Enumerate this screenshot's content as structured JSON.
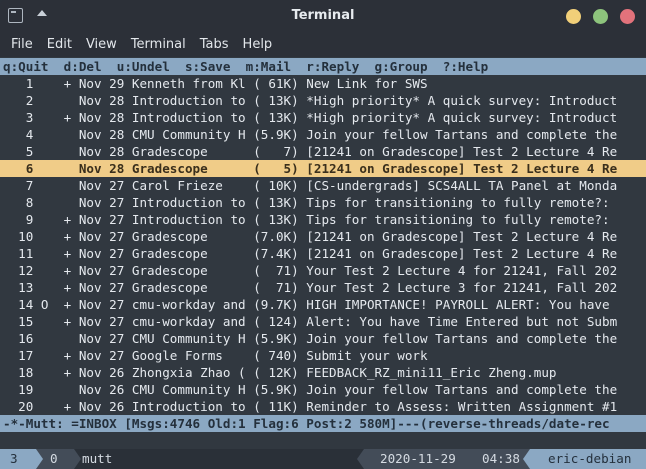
{
  "window": {
    "title": "Terminal"
  },
  "menu": [
    "File",
    "Edit",
    "View",
    "Terminal",
    "Tabs",
    "Help"
  ],
  "mutt": {
    "help": "q:Quit  d:Del  u:Undel  s:Save  m:Mail  r:Reply  g:Group  ?:Help",
    "messages": [
      "   1    + Nov 29 Kenneth from Kl ( 61K) New Link for SWS",
      "   2      Nov 28 Introduction to ( 13K) *High priority* A quick survey: Introduct",
      "   3    + Nov 28 Introduction to ( 13K) *High priority* A quick survey: Introduct",
      "   4      Nov 28 CMU Community H (5.9K) Join your fellow Tartans and complete the",
      "   5      Nov 28 Gradescope      (   7) [21241 on Gradescope] Test 2 Lecture 4 Re",
      "   6      Nov 28 Gradescope      (   5) [21241 on Gradescope] Test 2 Lecture 4 Re",
      "   7      Nov 27 Carol Frieze    ( 10K) [CS-undergrads] SCS4ALL TA Panel at Monda",
      "   8      Nov 27 Introduction to ( 13K) Tips for transitioning to fully remote?: ",
      "   9    + Nov 27 Introduction to ( 13K) Tips for transitioning to fully remote?: ",
      "  10    + Nov 27 Gradescope      (7.0K) [21241 on Gradescope] Test 2 Lecture 4 Re",
      "  11    + Nov 27 Gradescope      (7.4K) [21241 on Gradescope] Test 2 Lecture 4 Re",
      "  12    + Nov 27 Gradescope      (  71) Your Test 2 Lecture 4 for 21241, Fall 202",
      "  13    + Nov 27 Gradescope      (  71) Your Test 2 Lecture 3 for 21241, Fall 202",
      "  14 O  + Nov 27 cmu-workday and (9.7K) HIGH IMPORTANCE! PAYROLL ALERT: You have ",
      "  15    + Nov 27 cmu-workday and ( 124) Alert: You have Time Entered but not Subm",
      "  16      Nov 27 CMU Community H (5.9K) Join your fellow Tartans and complete the",
      "  17    + Nov 27 Google Forms    ( 740) Submit your work",
      "  18    + Nov 26 Zhongxia Zhao ( ( 12K) FEEDBACK_RZ_mini11_Eric Zheng.mup",
      "  19      Nov 26 CMU Community H (5.9K) Join your fellow Tartans and complete the",
      "  20    + Nov 26 Introduction to ( 11K) Reminder to Assess: Written Assignment #1"
    ],
    "selected_index": 5,
    "status": "-*-Mutt: =INBOX [Msgs:4746 Old:1 Flag:6 Post:2 580M]---(reverse-threads/date-rec"
  },
  "tmux": {
    "window": "3",
    "pane": "0",
    "command": "mutt",
    "date": "2020-11-29",
    "time": "04:38",
    "host": "eric-debian"
  },
  "colors": {
    "bar": "#8ba8c3",
    "selected": "#f0cc88",
    "background": "#313840"
  }
}
